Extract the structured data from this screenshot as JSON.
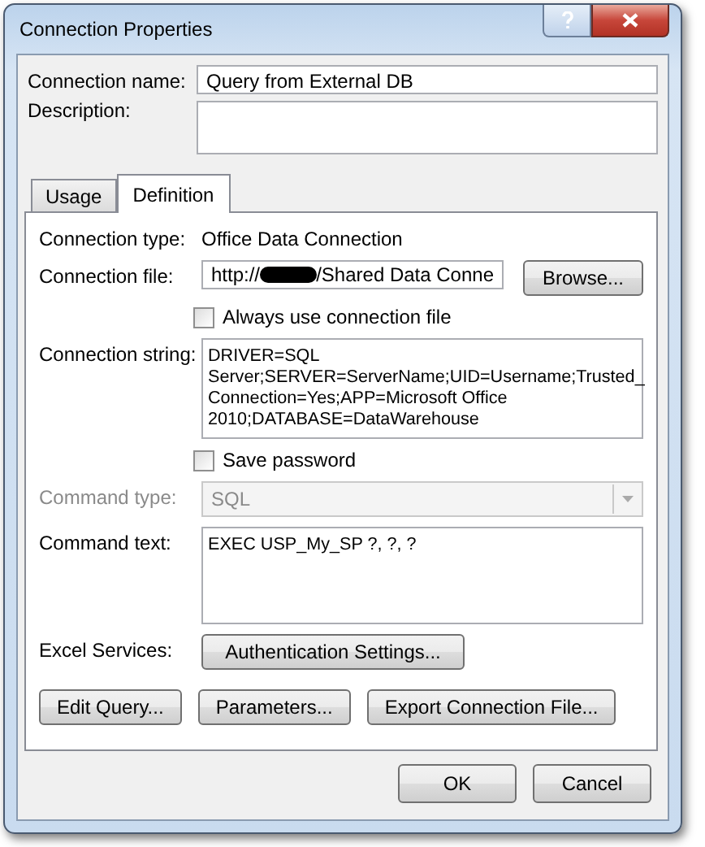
{
  "window": {
    "title": "Connection Properties"
  },
  "connection_name": {
    "label": "Connection name:",
    "value": "Query from External DB"
  },
  "description": {
    "label": "Description:"
  },
  "tabs": [
    {
      "label": "Usage",
      "selected": false
    },
    {
      "label": "Definition",
      "selected": true
    }
  ],
  "rows": [
    {
      "kind": "info",
      "label": "Connection type:",
      "value": "Office Data Connection"
    },
    {
      "kind": "file",
      "label": "Connection file:",
      "value": "http://",
      "value_end": "/Shared Data Conne",
      "redacted": true,
      "button": "Browse..."
    },
    {
      "kind": "checkbox",
      "label": "Always use connection file",
      "checked": false
    },
    {
      "kind": "textarea",
      "label": "Connection string:",
      "lines": [
        "DRIVER=SQL",
        "Server;SERVER=ServerName;UID=Username;Trusted_",
        "Connection=Yes;APP=Microsoft Office",
        "2010;DATABASE=DataWarehouse"
      ]
    },
    {
      "kind": "checkbox",
      "label": "Save password",
      "checked": false
    },
    {
      "kind": "select",
      "label": "Command type:",
      "value": "SQL",
      "disabled": true
    },
    {
      "kind": "textarea",
      "label": "Command text:",
      "lines": [
        "EXEC USP_My_SP ?, ?, ?"
      ]
    },
    {
      "kind": "button",
      "label": "Excel Services:",
      "button": "Authentication Settings..."
    }
  ],
  "panel_buttons": [
    "Edit Query...",
    "Parameters...",
    "Export Connection File..."
  ],
  "footer_buttons": [
    "OK",
    "Cancel"
  ]
}
